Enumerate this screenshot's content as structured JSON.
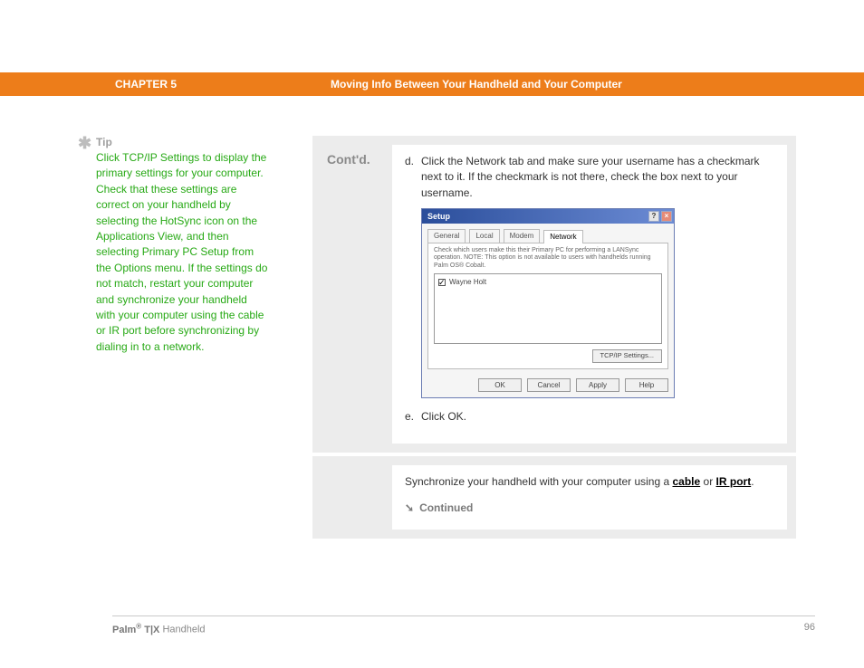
{
  "header": {
    "chapter_label": "CHAPTER 5",
    "chapter_title": "Moving Info Between Your Handheld and Your Computer"
  },
  "sidebar": {
    "tip_heading": "Tip",
    "tip_text": "Click TCP/IP Settings to display the primary settings for your computer. Check that these settings are correct on your handheld by selecting the HotSync icon on the Applications View, and then selecting Primary PC Setup from the Options menu. If the settings do not match, restart your computer and synchronize your handheld with your computer using the cable or IR port before synchronizing by dialing in to a network."
  },
  "content": {
    "block1": {
      "label": "Cont'd.",
      "step_d": {
        "letter": "d.",
        "text": "Click the Network tab and make sure your username has a checkmark next to it. If the checkmark is not there, check the box next to your username."
      },
      "dialog": {
        "title": "Setup",
        "tabs": [
          "General",
          "Local",
          "Modem",
          "Network"
        ],
        "note": "Check which users make this their Primary PC for performing a LANSync operation.\nNOTE: This option is not available to users with handhelds running Palm OS® Cobalt.",
        "list_item": "Wayne Holt",
        "tcpip_button": "TCP/IP Settings...",
        "buttons": [
          "OK",
          "Cancel",
          "Apply",
          "Help"
        ]
      },
      "step_e": {
        "letter": "e.",
        "text": "Click OK."
      }
    },
    "block2": {
      "sync_prefix": "Synchronize your handheld with your computer using a ",
      "cable_link": "cable",
      "or_word": " or ",
      "ir_link": "IR port",
      "period": ".",
      "continued": "Continued"
    }
  },
  "footer": {
    "product_bold": "Palm",
    "product_sup": "®",
    "product_mid": " T|X ",
    "product_light": "Handheld",
    "page": "96"
  }
}
